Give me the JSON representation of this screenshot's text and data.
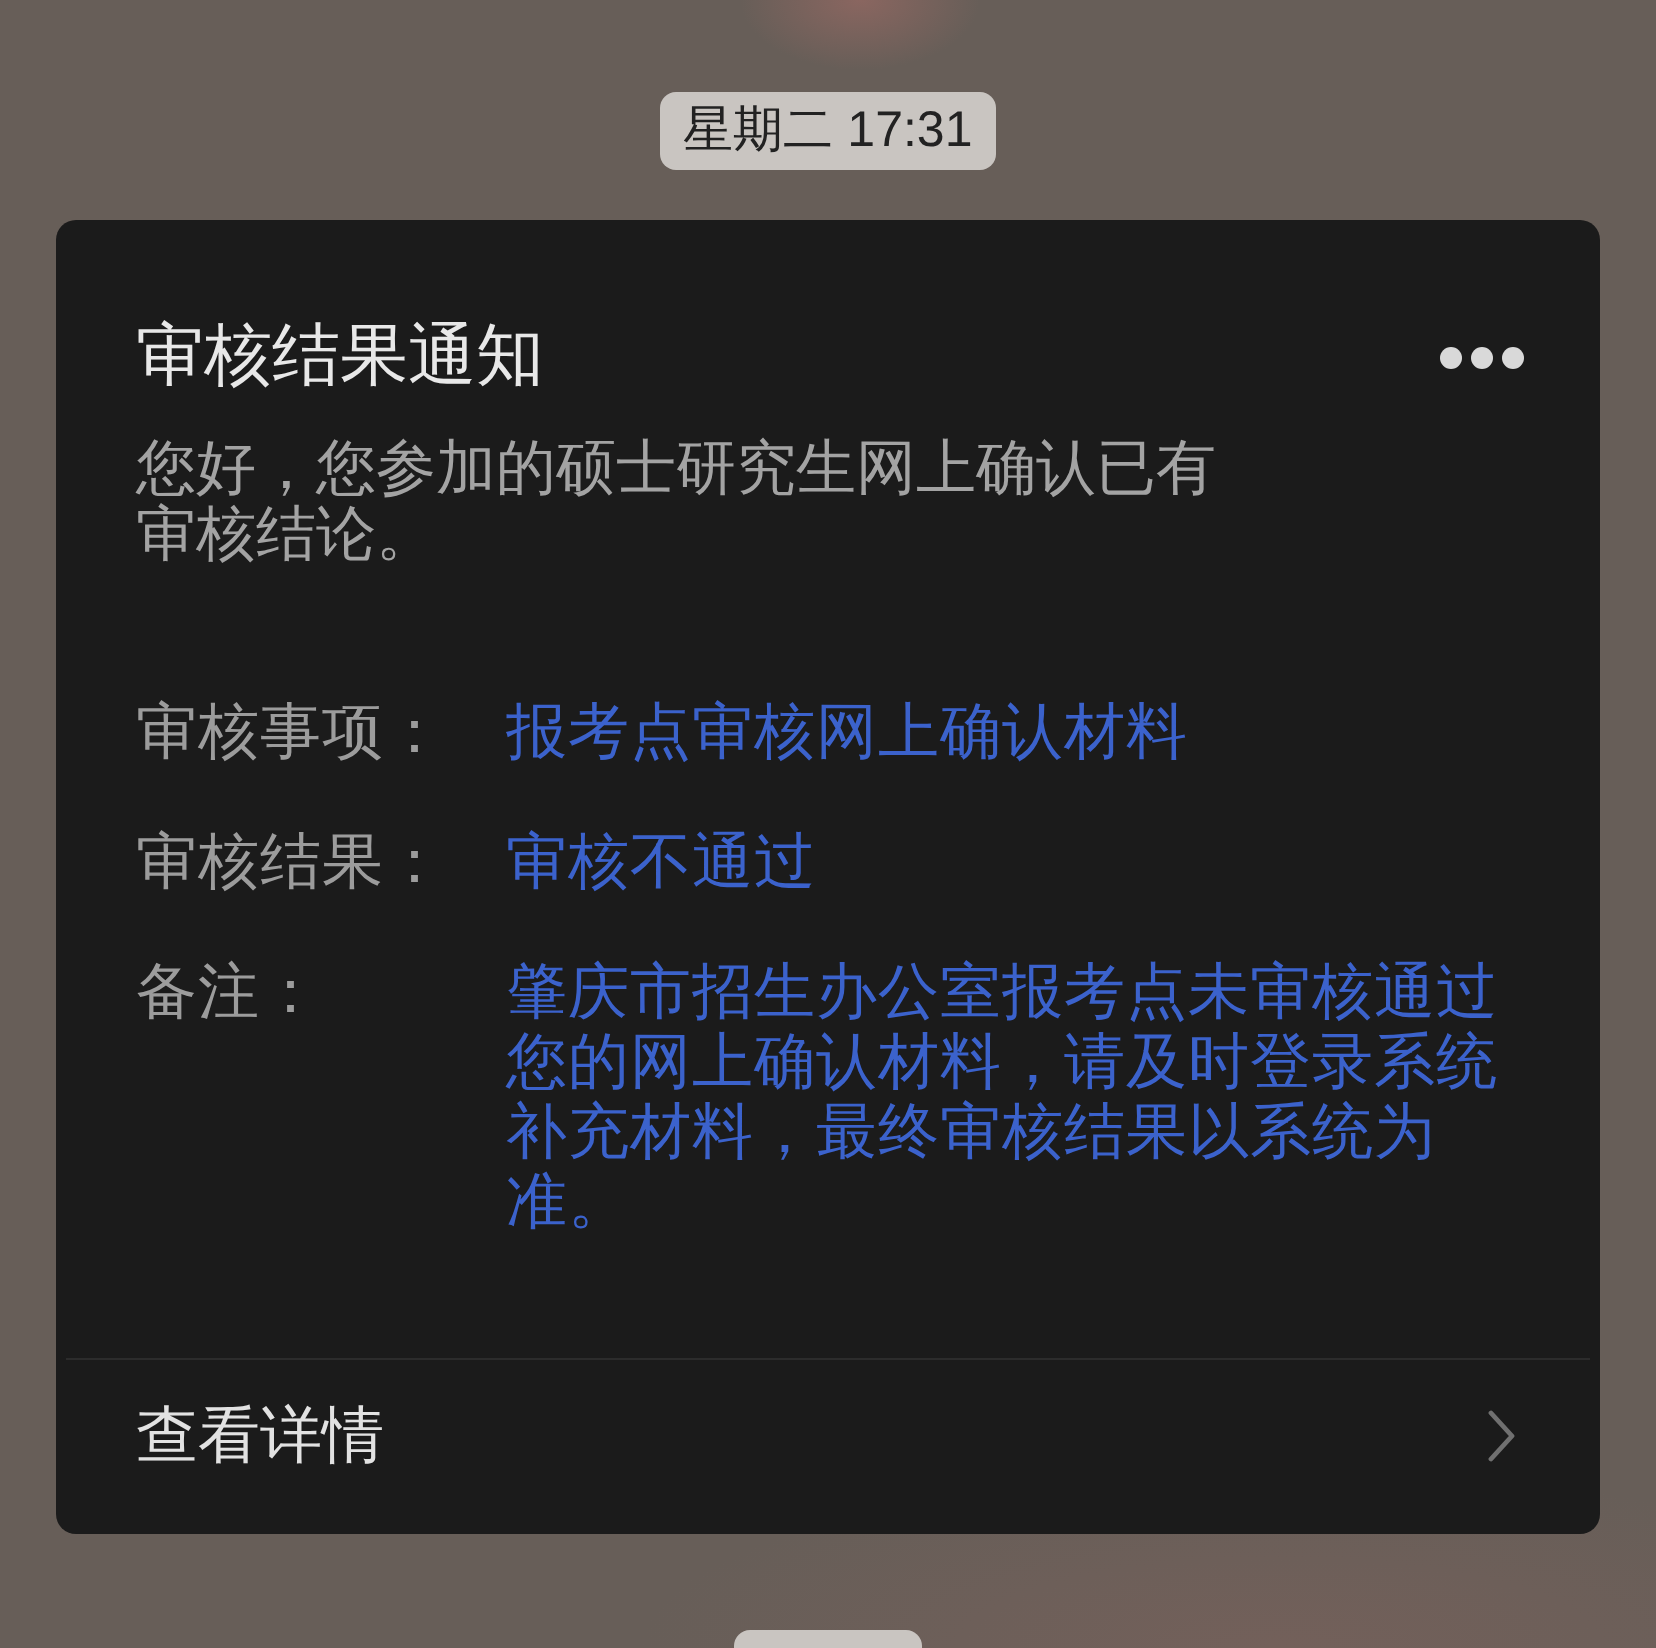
{
  "timestamp": "星期二 17:31",
  "card": {
    "title": "审核结果通知",
    "summary": "您好，您参加的硕士研究生网上确认已有审核结论。",
    "fields": [
      {
        "label": "审核事项：",
        "value": "报考点审核网上确认材料"
      },
      {
        "label": "审核结果：",
        "value": "审核不通过"
      },
      {
        "label": "备注：",
        "value": "肇庆市招生办公室报考点未审核通过您的网上确认材料，请及时登录系统补充材料，最终审核结果以系统为准。"
      }
    ],
    "footer_link": "查看详情"
  }
}
